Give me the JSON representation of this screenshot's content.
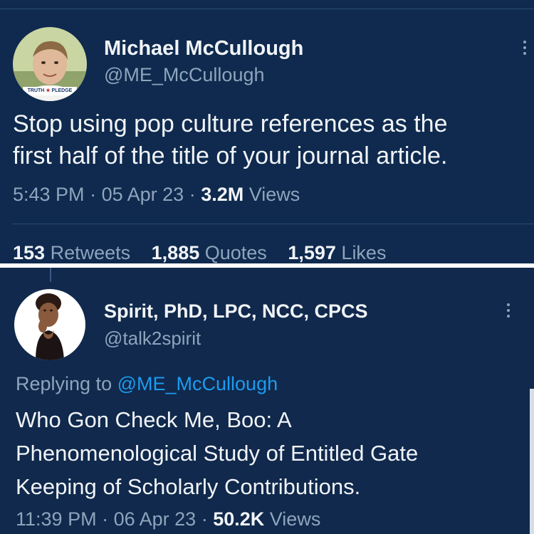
{
  "tweet1": {
    "author_name": "Michael McCullough",
    "handle": "@ME_McCullough",
    "avatar_badge_left": "TRUTH",
    "avatar_badge_right": "PLEDGE",
    "text_line1": "Stop using pop culture references as the",
    "text_line2": "first half of the title of your journal article.",
    "time": "5:43 PM",
    "date": "05 Apr 23",
    "views_count": "3.2M",
    "views_label": "Views",
    "retweets_count": "153",
    "retweets_label": "Retweets",
    "quotes_count": "1,885",
    "quotes_label": "Quotes",
    "likes_count": "1,597",
    "likes_label": "Likes",
    "more_icon": "more-vertical-icon"
  },
  "tweet2": {
    "author_name": "Spirit, PhD, LPC, NCC, CPCS",
    "handle": "@talk2spirit",
    "replying_prefix": "Replying to",
    "replying_handle": "@ME_McCullough",
    "text_line1": "Who Gon Check Me, Boo: A",
    "text_line2": "Phenomenological Study of Entitled Gate",
    "text_line3": "Keeping of Scholarly Contributions.",
    "time": "11:39 PM",
    "date": "06 Apr 23",
    "views_count": "50.2K",
    "views_label": "Views",
    "more_icon": "more-vertical-icon"
  },
  "colors": {
    "background": "#0f2a4e",
    "text": "#f1f4f8",
    "muted": "#8fa4bd",
    "link": "#1d9bf0"
  }
}
